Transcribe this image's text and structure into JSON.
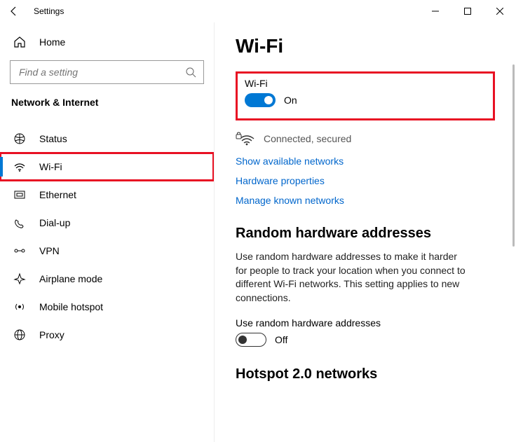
{
  "window": {
    "title": "Settings"
  },
  "sidebar": {
    "home": "Home",
    "search_placeholder": "Find a setting",
    "section": "Network & Internet",
    "items": [
      {
        "label": "Status"
      },
      {
        "label": "Wi-Fi"
      },
      {
        "label": "Ethernet"
      },
      {
        "label": "Dial-up"
      },
      {
        "label": "VPN"
      },
      {
        "label": "Airplane mode"
      },
      {
        "label": "Mobile hotspot"
      },
      {
        "label": "Proxy"
      }
    ]
  },
  "main": {
    "title": "Wi-Fi",
    "wifi_label": "Wi-Fi",
    "wifi_state": "On",
    "connection_status": "Connected, secured",
    "links": {
      "show_networks": "Show available networks",
      "hw_props": "Hardware properties",
      "manage_known": "Manage known networks"
    },
    "random_hw": {
      "heading": "Random hardware addresses",
      "desc": "Use random hardware addresses to make it harder for people to track your location when you connect to different Wi-Fi networks. This setting applies to new connections.",
      "toggle_label": "Use random hardware addresses",
      "toggle_state": "Off"
    },
    "hotspot_heading": "Hotspot 2.0 networks"
  }
}
